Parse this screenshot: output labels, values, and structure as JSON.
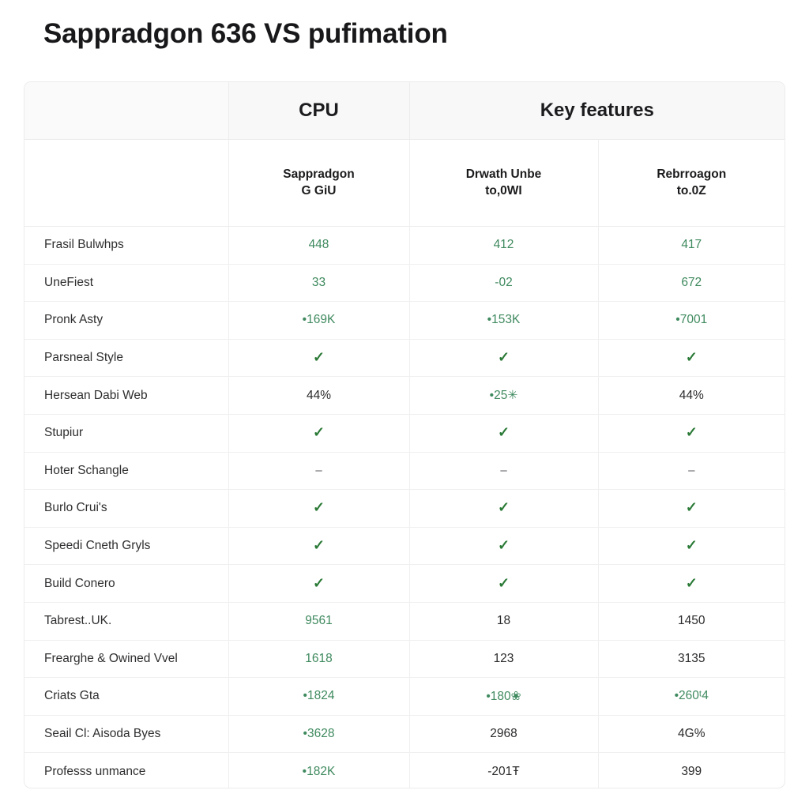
{
  "page": {
    "title": "Sappradgon 636 VS pufimation",
    "background_color": "#ffffff"
  },
  "colors": {
    "green_value": "#3f8a5f",
    "green_check": "#2b7a37",
    "dark_text": "#2b2b2d",
    "header_band": "#f8f8f9",
    "border": "#ececec"
  },
  "table": {
    "group_headers": [
      {
        "label": "",
        "span": 1
      },
      {
        "label": "CPU",
        "span": 1
      },
      {
        "label": "Key features",
        "span": 2
      }
    ],
    "column_headers": [
      {
        "line1": "",
        "line2": ""
      },
      {
        "line1": "Sappradgon",
        "line2": "G GiU"
      },
      {
        "line1": "Drwath Unbe",
        "line2": "to,0WI"
      },
      {
        "line1": "Rebrroagon",
        "line2": "to.0Z"
      }
    ],
    "rows": [
      {
        "label": "Frasil Bulwhps",
        "cells": [
          {
            "text": "448",
            "style": "green"
          },
          {
            "text": "412",
            "style": "green"
          },
          {
            "text": "417",
            "style": "green"
          }
        ]
      },
      {
        "label": "UneFiest",
        "cells": [
          {
            "text": "33",
            "style": "green"
          },
          {
            "text": "-02",
            "style": "green"
          },
          {
            "text": "672",
            "style": "green"
          }
        ]
      },
      {
        "label": "Pronk Asty",
        "cells": [
          {
            "text": "•169K",
            "style": "green"
          },
          {
            "text": "•153K",
            "style": "green"
          },
          {
            "text": "•7001",
            "style": "green"
          }
        ]
      },
      {
        "label": "Parsneal Style",
        "cells": [
          {
            "text": "✓",
            "style": "check"
          },
          {
            "text": "✓",
            "style": "check"
          },
          {
            "text": "✓",
            "style": "check"
          }
        ]
      },
      {
        "label": "Hersean Dabi Web",
        "cells": [
          {
            "text": "44%",
            "style": "dark"
          },
          {
            "text": "•25✳",
            "style": "green"
          },
          {
            "text": "44%",
            "style": "dark"
          }
        ]
      },
      {
        "label": "Stupiur",
        "cells": [
          {
            "text": "✓",
            "style": "check"
          },
          {
            "text": "✓",
            "style": "check"
          },
          {
            "text": "✓",
            "style": "check"
          }
        ]
      },
      {
        "label": "Hoter Schangle",
        "cells": [
          {
            "text": "–",
            "style": "dash"
          },
          {
            "text": "–",
            "style": "dash"
          },
          {
            "text": "–",
            "style": "dash"
          }
        ]
      },
      {
        "label": "Burlo Crui's",
        "cells": [
          {
            "text": "✓",
            "style": "check"
          },
          {
            "text": "✓",
            "style": "check"
          },
          {
            "text": "✓",
            "style": "check"
          }
        ]
      },
      {
        "label": "Speedi Cneth Gryls",
        "cells": [
          {
            "text": "✓",
            "style": "check"
          },
          {
            "text": "✓",
            "style": "check"
          },
          {
            "text": "✓",
            "style": "check"
          }
        ]
      },
      {
        "label": "Build Conero",
        "cells": [
          {
            "text": "✓",
            "style": "check"
          },
          {
            "text": "✓",
            "style": "check"
          },
          {
            "text": "✓",
            "style": "check"
          }
        ]
      },
      {
        "label": "Tabrest..UK.",
        "cells": [
          {
            "text": "9561",
            "style": "green"
          },
          {
            "text": "18",
            "style": "dark"
          },
          {
            "text": "1450",
            "style": "dark"
          }
        ]
      },
      {
        "label": "Frearghe & Owined Vvel",
        "cells": [
          {
            "text": "1618",
            "style": "green"
          },
          {
            "text": "123",
            "style": "dark"
          },
          {
            "text": "3135",
            "style": "dark"
          }
        ]
      },
      {
        "label": "Criats Gta",
        "cells": [
          {
            "text": "•1824",
            "style": "green"
          },
          {
            "text": "•180❀",
            "style": "green"
          },
          {
            "text": "•260ᵗ4",
            "style": "green"
          }
        ]
      },
      {
        "label": "Seail Cl: Aisoda Byes",
        "cells": [
          {
            "text": "•3628",
            "style": "green"
          },
          {
            "text": "2968",
            "style": "dark"
          },
          {
            "text": "4G%",
            "style": "dark"
          }
        ]
      },
      {
        "label": "Professs unmance",
        "cells": [
          {
            "text": "•182K",
            "style": "green"
          },
          {
            "text": "-201Ŧ",
            "style": "dark"
          },
          {
            "text": "399",
            "style": "dark"
          }
        ]
      }
    ]
  }
}
